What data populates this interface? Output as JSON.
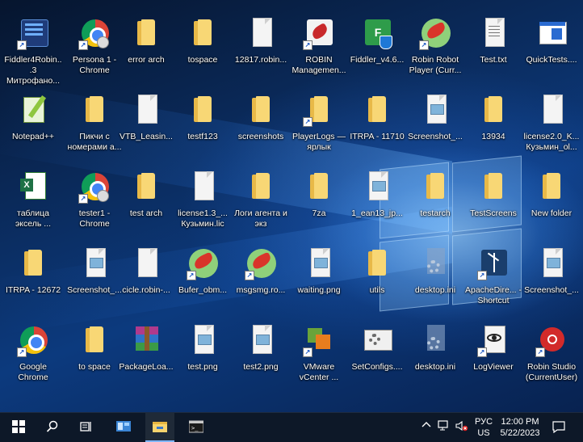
{
  "desktop": {
    "icons": [
      {
        "label": "Fiddler4Robin...3 Митрофано...",
        "type": "app-robinmonitor"
      },
      {
        "label": "Persona 1 - Chrome",
        "type": "chrome-user"
      },
      {
        "label": "error arch",
        "type": "folder"
      },
      {
        "label": "tospace",
        "type": "folder"
      },
      {
        "label": "12817.robin...",
        "type": "file"
      },
      {
        "label": "ROBIN Managemen...",
        "type": "robin-mgmt"
      },
      {
        "label": "Fiddler_v4.6...",
        "type": "fiddler"
      },
      {
        "label": "Robin Robot Player (Curr...",
        "type": "robin"
      },
      {
        "label": "Test.txt",
        "type": "text"
      },
      {
        "label": "QuickTests....",
        "type": "window-app"
      },
      {
        "label": "Notepad++",
        "type": "notepad"
      },
      {
        "label": "Пикчи с номерами а...",
        "type": "folder"
      },
      {
        "label": "VTB_Leasin...",
        "type": "file"
      },
      {
        "label": "testf123",
        "type": "folder"
      },
      {
        "label": "screenshots",
        "type": "folder"
      },
      {
        "label": "PlayerLogs — ярлык",
        "type": "folder-shortcut"
      },
      {
        "label": "ITRPA - 11710",
        "type": "folder"
      },
      {
        "label": "Screenshot_...",
        "type": "image"
      },
      {
        "label": "13934",
        "type": "folder"
      },
      {
        "label": "license2.0_K... Кузьмин_ol...",
        "type": "file"
      },
      {
        "label": "таблица эксель ...",
        "type": "excel"
      },
      {
        "label": "tester1 - Chrome",
        "type": "chrome-user"
      },
      {
        "label": "test arch",
        "type": "folder"
      },
      {
        "label": "license1.3_... Кузьмин.lic",
        "type": "file"
      },
      {
        "label": "Логи агента и экз",
        "type": "folder"
      },
      {
        "label": "7za",
        "type": "folder"
      },
      {
        "label": "1_ean13_jp...",
        "type": "image"
      },
      {
        "label": "testarch",
        "type": "folder"
      },
      {
        "label": "TestScreens",
        "type": "folder"
      },
      {
        "label": "New folder",
        "type": "folder"
      },
      {
        "label": "ITRPA - 12672",
        "type": "folder"
      },
      {
        "label": "Screenshot_...",
        "type": "image"
      },
      {
        "label": "cicle.robin-...",
        "type": "file"
      },
      {
        "label": "Bufer_obm...",
        "type": "robin"
      },
      {
        "label": "msgsmg.ro...",
        "type": "robin"
      },
      {
        "label": "waiting.png",
        "type": "image"
      },
      {
        "label": "utils",
        "type": "folder"
      },
      {
        "label": "desktop.ini",
        "type": "gear-file"
      },
      {
        "label": "ApacheDire... - Shortcut",
        "type": "apache"
      },
      {
        "label": "Screenshot_...",
        "type": "image"
      },
      {
        "label": "Google Chrome",
        "type": "chrome"
      },
      {
        "label": "to space",
        "type": "folder"
      },
      {
        "label": "PackageLoa...",
        "type": "winrar"
      },
      {
        "label": "test.png",
        "type": "image"
      },
      {
        "label": "test2.png",
        "type": "image"
      },
      {
        "label": "VMware vCenter ...",
        "type": "vmware"
      },
      {
        "label": "SetConfigs....",
        "type": "gear-window"
      },
      {
        "label": "desktop.ini",
        "type": "gear-file"
      },
      {
        "label": "LogViewer",
        "type": "logviewer"
      },
      {
        "label": "Robin Studio (CurrentUser)",
        "type": "robin-studio"
      }
    ]
  },
  "taskbar": {
    "items": [
      "start",
      "search",
      "task-view",
      "server-manager",
      "file-explorer",
      "command-prompt"
    ],
    "language": "РУС",
    "region": "US",
    "time": "12:00 PM",
    "date": "5/22/2023"
  },
  "colors": {
    "taskbar": "#0d1828",
    "folder": "#f8d775",
    "wallpaper": "#0b2e63"
  }
}
